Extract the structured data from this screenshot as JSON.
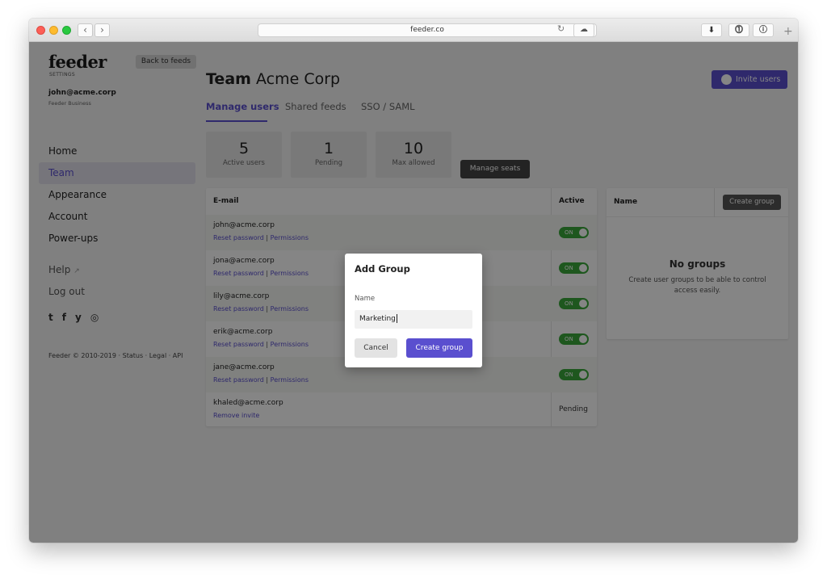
{
  "browser": {
    "url": "feeder.co",
    "back_glyph": "‹",
    "forward_glyph": "›",
    "reload_glyph": "↻",
    "cloud_glyph": "☁",
    "ext_glyphs": [
      "⬇",
      "⓵",
      "ⓘ"
    ],
    "new_tab_glyph": "+"
  },
  "sidebar": {
    "logo": "feeder",
    "logo_sub": "SETTINGS",
    "back_button": "Back to feeds",
    "user_email": "john@acme.corp",
    "user_plan": "Feeder Business",
    "nav": [
      {
        "label": "Home"
      },
      {
        "label": "Team"
      },
      {
        "label": "Appearance"
      },
      {
        "label": "Account"
      },
      {
        "label": "Power-ups"
      }
    ],
    "help": "Help",
    "help_icon": "↗",
    "logout": "Log out",
    "socials": [
      "t",
      "f",
      "y",
      "◎"
    ],
    "footer": "Feeder © 2010-2019 · Status · Legal · API"
  },
  "header": {
    "title_bold": "Team",
    "title_rest": " Acme Corp",
    "invite_button": "Invite users"
  },
  "tabs": [
    {
      "label": "Manage users"
    },
    {
      "label": "Shared feeds"
    },
    {
      "label": "SSO / SAML"
    }
  ],
  "stats": [
    {
      "value": "5",
      "label": "Active users"
    },
    {
      "value": "1",
      "label": "Pending"
    },
    {
      "value": "10",
      "label": "Max allowed"
    }
  ],
  "manage_seats_button": "Manage seats",
  "users_table": {
    "col_email": "E-mail",
    "col_active": "Active",
    "reset_label": "Reset password",
    "permissions_label": "Permissions",
    "sep": "|",
    "rows": [
      {
        "email": "john@acme.corp",
        "status": "ON"
      },
      {
        "email": "jona@acme.corp",
        "status": "ON"
      },
      {
        "email": "lily@acme.corp",
        "status": "ON"
      },
      {
        "email": "erik@acme.corp",
        "status": "ON"
      },
      {
        "email": "jane@acme.corp",
        "status": "ON"
      }
    ],
    "pending_row": {
      "email": "khaled@acme.corp",
      "action": "Remove invite",
      "status": "Pending"
    }
  },
  "groups": {
    "col_name": "Name",
    "create_button": "Create group",
    "empty_title": "No groups",
    "empty_desc": "Create user groups to be able to control access easily."
  },
  "modal": {
    "title": "Add Group",
    "name_label": "Name",
    "name_value": "Marketing",
    "cancel_button": "Cancel",
    "create_button": "Create group"
  },
  "colors": {
    "accent": "#5a4fcf",
    "toggle_on": "#3aa83a",
    "overlay": "rgba(0,0,0,0.48)"
  }
}
